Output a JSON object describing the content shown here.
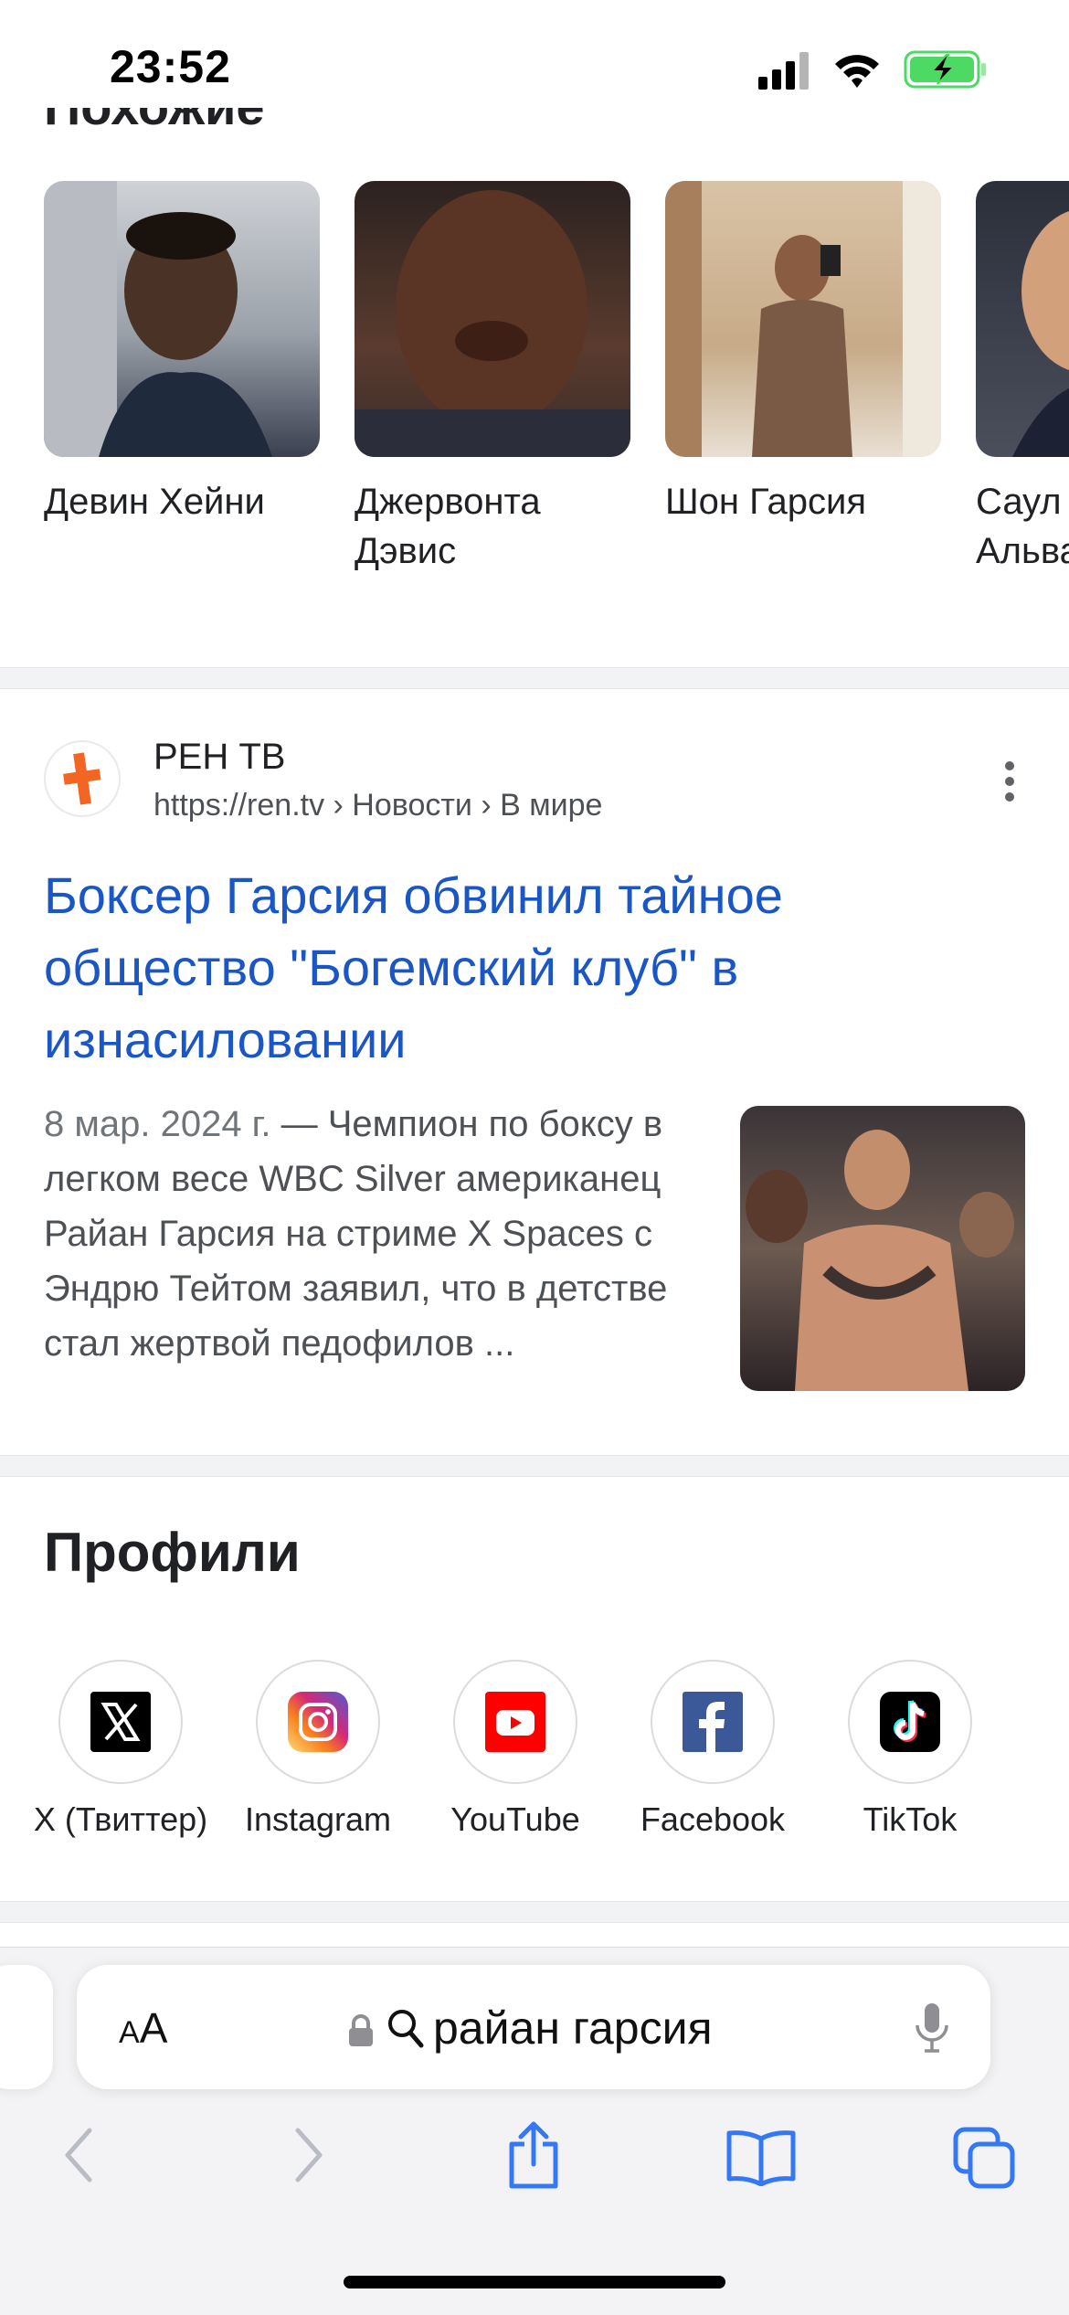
{
  "status_bar": {
    "time": "23:52"
  },
  "people": {
    "heading_partial": "Похожие запросы",
    "items": [
      {
        "name": "Девин Хейни"
      },
      {
        "name_line1": "Джервонта",
        "name_line2": "Дэвис"
      },
      {
        "name": "Шон Гарсия"
      },
      {
        "name_line1": "Саул",
        "name_line2": "Альва"
      }
    ]
  },
  "result": {
    "site_name": "РЕН ТВ",
    "url": "https://ren.tv › Новости › В мире",
    "title": "Боксер Гарсия обвинил тайное общество \"Богемский клуб\" в изнасиловании",
    "date": "8 мар. 2024 г.",
    "snippet": " — Чемпион по боксу в легком весе WBC Silver американец Райан Гарсия на стриме X Spaces с Эндрю Тейтом заявил, что в детстве стал жертвой педофилов ..."
  },
  "profiles": {
    "title": "Профили",
    "items": [
      {
        "label": "X (Твиттер)",
        "icon": "x-icon"
      },
      {
        "label": "Instagram",
        "icon": "instagram-icon"
      },
      {
        "label": "YouTube",
        "icon": "youtube-icon"
      },
      {
        "label": "Facebook",
        "icon": "facebook-icon"
      },
      {
        "label": "TikTok",
        "icon": "tiktok-icon"
      }
    ]
  },
  "address_bar": {
    "aa_small": "A",
    "aa_large": "A",
    "query": "райан гарсия"
  },
  "colors": {
    "link": "#1a56c5",
    "safari_blue": "#3478f6",
    "ren_tv_orange": "#f26522"
  }
}
